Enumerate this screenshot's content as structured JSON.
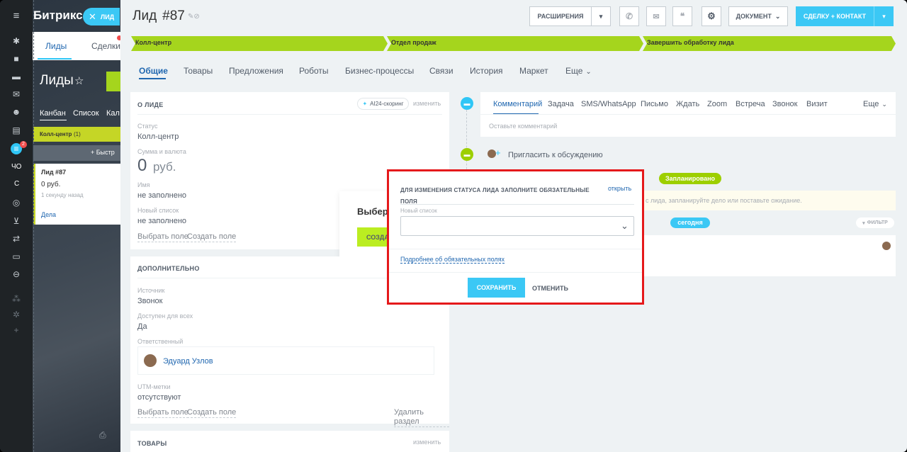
{
  "app": {
    "brand": "Битрикс",
    "lead_pill": "ЛИД"
  },
  "leftbar": {
    "labels": [
      "ЧО",
      "С"
    ],
    "badge": "2"
  },
  "bg": {
    "tabs": [
      "Лиды",
      "Сделки"
    ],
    "title": "Лиды",
    "views": [
      "Канбан",
      "Список",
      "Кал"
    ],
    "column": "Колл-центр",
    "column_count": "(1)",
    "quick_add": "+ Быстр",
    "card_title": "Лид #87",
    "card_sum": "0 руб.",
    "card_time": "1 секунду назад",
    "card_link": "Дела"
  },
  "header": {
    "title": "Лид",
    "number": "#87",
    "extensions": "РАСШИРЕНИЯ",
    "document": "ДОКУМЕНТ",
    "deal_contact": "СДЕЛКУ + КОНТАКТ"
  },
  "stages": [
    "Колл-центр",
    "Отдел продаж",
    "Завершить обработку лида"
  ],
  "tabs": [
    "Общие",
    "Товары",
    "Предложения",
    "Роботы",
    "Бизнес-процессы",
    "Связи",
    "История",
    "Маркет",
    "Еще"
  ],
  "about": {
    "heading": "О ЛИДЕ",
    "scoring": "AI24-скоринг",
    "edit": "изменить",
    "status_label": "Статус",
    "status": "Колл-центр",
    "sum_label": "Сумма и валюта",
    "sum_value": "0",
    "sum_currency": "руб.",
    "name_label": "Имя",
    "name_value": "не заполнено",
    "list_label": "Новый список",
    "list_value": "не заполнено",
    "choose_field": "Выбрать поле",
    "create_field": "Создать поле"
  },
  "popup": {
    "title": "Выбери",
    "button": "СОЗДА"
  },
  "extra": {
    "heading": "ДОПОЛНИТЕЛЬНО",
    "source_label": "Источник",
    "source": "Звонок",
    "access_label": "Доступен для всех",
    "access": "Да",
    "resp_label": "Ответственный",
    "resp": "Эдуард Узлов",
    "utm_label": "UTM-метки",
    "utm": "отсутствуют",
    "choose_field": "Выбрать поле",
    "create_field": "Создать поле",
    "delete": "Удалить раздел"
  },
  "products": {
    "heading": "ТОВАРЫ",
    "edit": "изменить"
  },
  "timeline": {
    "tabs": [
      "Комментарий",
      "Задача",
      "SMS/WhatsApp",
      "Письмо",
      "Ждать",
      "Zoom",
      "Встреча",
      "Звонок",
      "Визит"
    ],
    "more": "Еще",
    "placeholder": "Оставьте комментарий",
    "invite": "Пригласить к обсуждению",
    "planned": "Запланировано",
    "hint": "с лида, запланируйте дело или поставьте ожидание.",
    "today": "сегодня",
    "filter": "ФИЛЬТР"
  },
  "modal": {
    "title": "ДЛЯ ИЗМЕНЕНИЯ СТАТУСА ЛИДА ЗАПОЛНИТЕ ОБЯЗАТЕЛЬНЫЕ ПОЛЯ",
    "open": "открыть",
    "field_label": "Новый список",
    "select_value": "",
    "more_link": "Подробнее об обязательных полях",
    "save": "СОХРАНИТЬ",
    "cancel": "ОТМЕНИТЬ"
  },
  "colors": {
    "accent": "#3bc8f5",
    "stage": "#a5d51d",
    "highlight": "#e5191b"
  }
}
